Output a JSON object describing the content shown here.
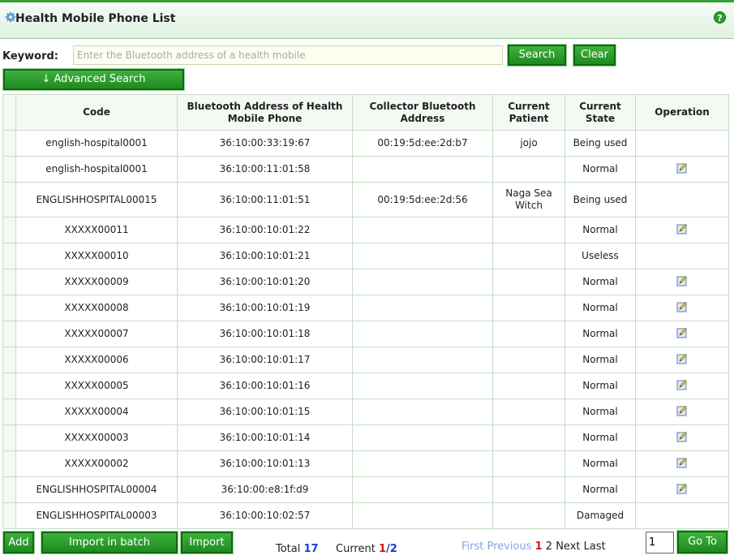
{
  "header": {
    "title": "Health Mobile Phone List",
    "help_icon": "help-icon",
    "title_icon": "gear-icon"
  },
  "search": {
    "keyword_label": "Keyword:",
    "placeholder": "Enter the Bluetooth address of a health mobile",
    "value": "",
    "search_label": "Search",
    "clear_label": "Clear",
    "advanced_label": "↓ Advanced Search"
  },
  "table": {
    "columns": [
      "Code",
      "Bluetooth Address of Health Mobile Phone",
      "Collector Bluetooth Address",
      "Current Patient",
      "Current State",
      "Operation"
    ],
    "rows": [
      {
        "code": "english-hospital0001",
        "bt": "36:10:00:33:19:67",
        "collector": "00:19:5d:ee:2d:b7",
        "patient": "jojo",
        "state": "Being used",
        "edit": false
      },
      {
        "code": "english-hospital0001",
        "bt": "36:10:00:11:01:58",
        "collector": "",
        "patient": "",
        "state": "Normal",
        "edit": true
      },
      {
        "code": "ENGLISHHOSPITAL00015",
        "bt": "36:10:00:11:01:51",
        "collector": "00:19:5d:ee:2d:56",
        "patient": "Naga Sea Witch",
        "state": "Being used",
        "edit": false
      },
      {
        "code": "XXXXX00011",
        "bt": "36:10:00:10:01:22",
        "collector": "",
        "patient": "",
        "state": "Normal",
        "edit": true
      },
      {
        "code": "XXXXX00010",
        "bt": "36:10:00:10:01:21",
        "collector": "",
        "patient": "",
        "state": "Useless",
        "edit": false
      },
      {
        "code": "XXXXX00009",
        "bt": "36:10:00:10:01:20",
        "collector": "",
        "patient": "",
        "state": "Normal",
        "edit": true
      },
      {
        "code": "XXXXX00008",
        "bt": "36:10:00:10:01:19",
        "collector": "",
        "patient": "",
        "state": "Normal",
        "edit": true
      },
      {
        "code": "XXXXX00007",
        "bt": "36:10:00:10:01:18",
        "collector": "",
        "patient": "",
        "state": "Normal",
        "edit": true
      },
      {
        "code": "XXXXX00006",
        "bt": "36:10:00:10:01:17",
        "collector": "",
        "patient": "",
        "state": "Normal",
        "edit": true
      },
      {
        "code": "XXXXX00005",
        "bt": "36:10:00:10:01:16",
        "collector": "",
        "patient": "",
        "state": "Normal",
        "edit": true
      },
      {
        "code": "XXXXX00004",
        "bt": "36:10:00:10:01:15",
        "collector": "",
        "patient": "",
        "state": "Normal",
        "edit": true
      },
      {
        "code": "XXXXX00003",
        "bt": "36:10:00:10:01:14",
        "collector": "",
        "patient": "",
        "state": "Normal",
        "edit": true
      },
      {
        "code": "XXXXX00002",
        "bt": "36:10:00:10:01:13",
        "collector": "",
        "patient": "",
        "state": "Normal",
        "edit": true
      },
      {
        "code": "ENGLISHHOSPITAL00004",
        "bt": "36:10:00:e8:1f:d9",
        "collector": "",
        "patient": "",
        "state": "Normal",
        "edit": true
      },
      {
        "code": "ENGLISHHOSPITAL00003",
        "bt": "36:10:00:10:02:57",
        "collector": "",
        "patient": "",
        "state": "Damaged",
        "edit": false
      }
    ],
    "edit_icon": "edit-icon"
  },
  "footer": {
    "add_label": "Add",
    "import_batch_label": "Import in batch",
    "import_label": "Import",
    "total_label": "Total",
    "total_value": "17",
    "current_label": "Current",
    "current_page": "1",
    "page_sep": "/",
    "total_pages": "2",
    "first_label": "First",
    "previous_label": "Previous",
    "page1": "1",
    "page2": "2",
    "next_label": "Next",
    "last_label": "Last",
    "page_input_value": "1",
    "goto_label": "Go To"
  },
  "colors": {
    "accent_green": "#1e8a1e",
    "border_green": "#c6dcc6",
    "current_red": "#d01818",
    "total_blue": "#1b3fd1",
    "disabled_link": "#8aa2d8"
  }
}
